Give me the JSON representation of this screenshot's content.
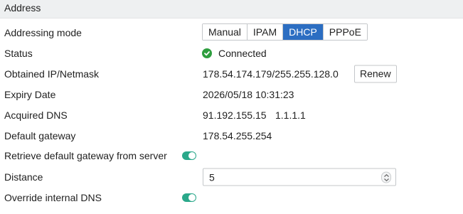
{
  "section": {
    "title": "Address"
  },
  "addressing_mode": {
    "label": "Addressing mode",
    "options": [
      "Manual",
      "IPAM",
      "DHCP",
      "PPPoE"
    ],
    "selected": "DHCP"
  },
  "status": {
    "label": "Status",
    "value": "Connected",
    "icon": "check-circle-icon",
    "color": "#2e9e3e"
  },
  "obtained_ip": {
    "label": "Obtained IP/Netmask",
    "value": "178.54.174.179/255.255.128.0",
    "renew_label": "Renew"
  },
  "expiry": {
    "label": "Expiry Date",
    "value": "2026/05/18 10:31:23"
  },
  "acquired_dns": {
    "label": "Acquired DNS",
    "values": [
      "91.192.155.15",
      "1.1.1.1"
    ]
  },
  "default_gateway": {
    "label": "Default gateway",
    "value": "178.54.255.254"
  },
  "retrieve_gateway": {
    "label": "Retrieve default gateway from server",
    "enabled": true
  },
  "distance": {
    "label": "Distance",
    "value": "5"
  },
  "override_dns": {
    "label": "Override internal DNS",
    "enabled": true
  },
  "colors": {
    "accent": "#2c6ec2",
    "toggle_on": "#2aa88a",
    "success": "#2e9e3e",
    "header_bg": "#eef0f1"
  }
}
